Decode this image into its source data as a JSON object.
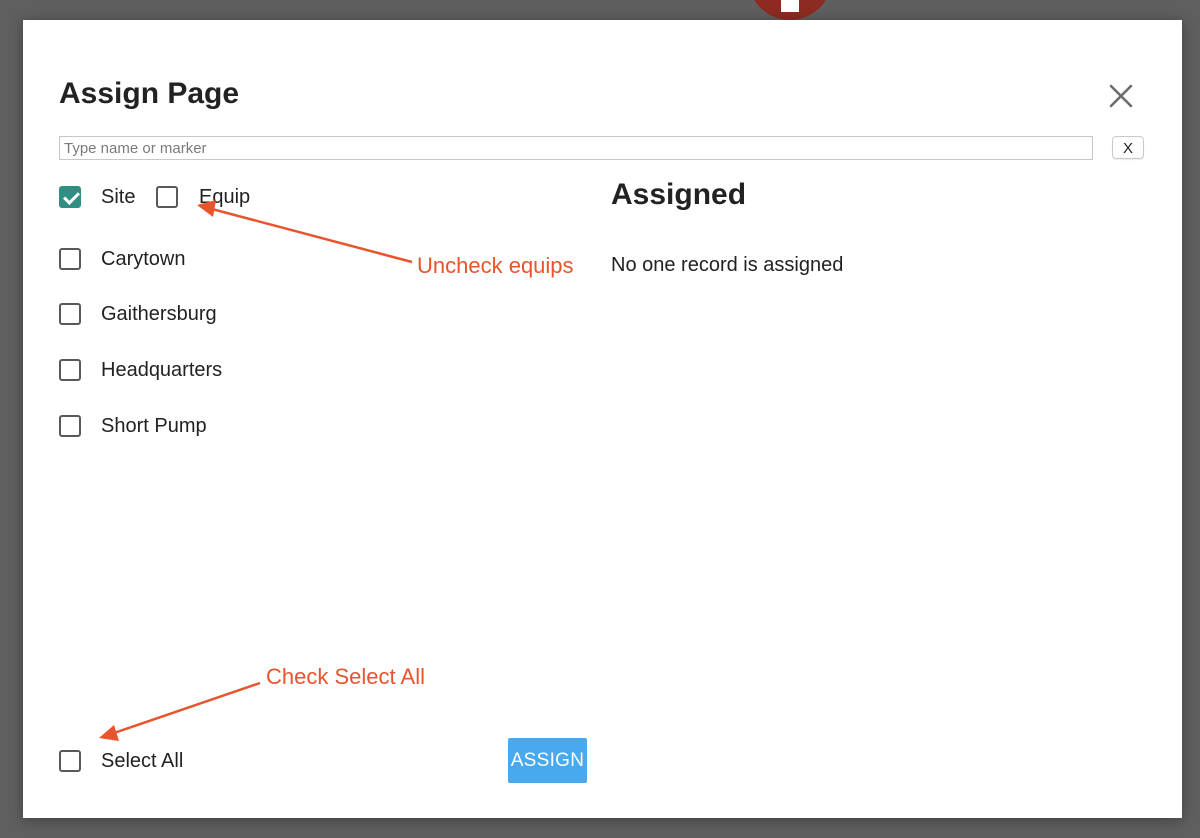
{
  "dialog": {
    "title": "Assign Page",
    "close_icon": "close-icon"
  },
  "search": {
    "placeholder": "Type name or marker",
    "value": "",
    "clear_label": "X"
  },
  "filters": [
    {
      "label": "Site",
      "checked": true
    },
    {
      "label": "Equip",
      "checked": false
    }
  ],
  "sites": [
    {
      "label": "Carytown",
      "checked": false
    },
    {
      "label": "Gaithersburg",
      "checked": false
    },
    {
      "label": "Headquarters",
      "checked": false
    },
    {
      "label": "Short Pump",
      "checked": false
    }
  ],
  "assigned": {
    "heading": "Assigned",
    "empty_text": "No one record is assigned"
  },
  "footer": {
    "select_all_label": "Select All",
    "select_all_checked": false,
    "assign_label": "ASSIGN"
  },
  "annotations": {
    "uncheck_equips": "Uncheck equips",
    "check_select_all": "Check Select All",
    "color": "#e8542b"
  },
  "colors": {
    "checkbox_checked": "#2f8f83",
    "assign_button": "#48a9ee"
  }
}
